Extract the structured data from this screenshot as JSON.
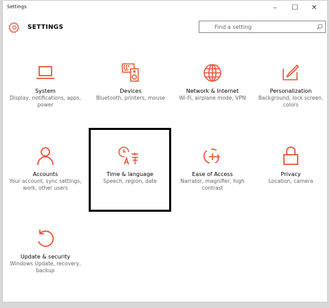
{
  "window": {
    "app_name": "Settings",
    "minimize_label": "–",
    "maximize_label": "☐",
    "close_label": "✕"
  },
  "header": {
    "title": "SETTINGS",
    "search_placeholder": "Find a setting"
  },
  "colors": {
    "accent": "#e8553a"
  },
  "tiles": [
    {
      "label": "System",
      "desc": "Display, notifications, apps, power",
      "icon": "laptop-icon"
    },
    {
      "label": "Devices",
      "desc": "Bluetooth, printers, mouse",
      "icon": "keyboard-speaker-icon"
    },
    {
      "label": "Network & Internet",
      "desc": "Wi-Fi, airplane mode, VPN",
      "icon": "globe-icon"
    },
    {
      "label": "Personalization",
      "desc": "Background, lock screen, colors",
      "icon": "paintbrush-icon"
    },
    {
      "label": "Accounts",
      "desc": "Your account, sync settings, work, other users",
      "icon": "person-icon"
    },
    {
      "label": "Time & language",
      "desc": "Speech, region, date",
      "icon": "clock-language-icon"
    },
    {
      "label": "Ease of Access",
      "desc": "Narrator, magnifier, high contrast",
      "icon": "ease-of-access-icon"
    },
    {
      "label": "Privacy",
      "desc": "Location, camera",
      "icon": "lock-icon"
    },
    {
      "label": "Update & security",
      "desc": "Windows Update, recovery, backup",
      "icon": "refresh-icon"
    }
  ]
}
